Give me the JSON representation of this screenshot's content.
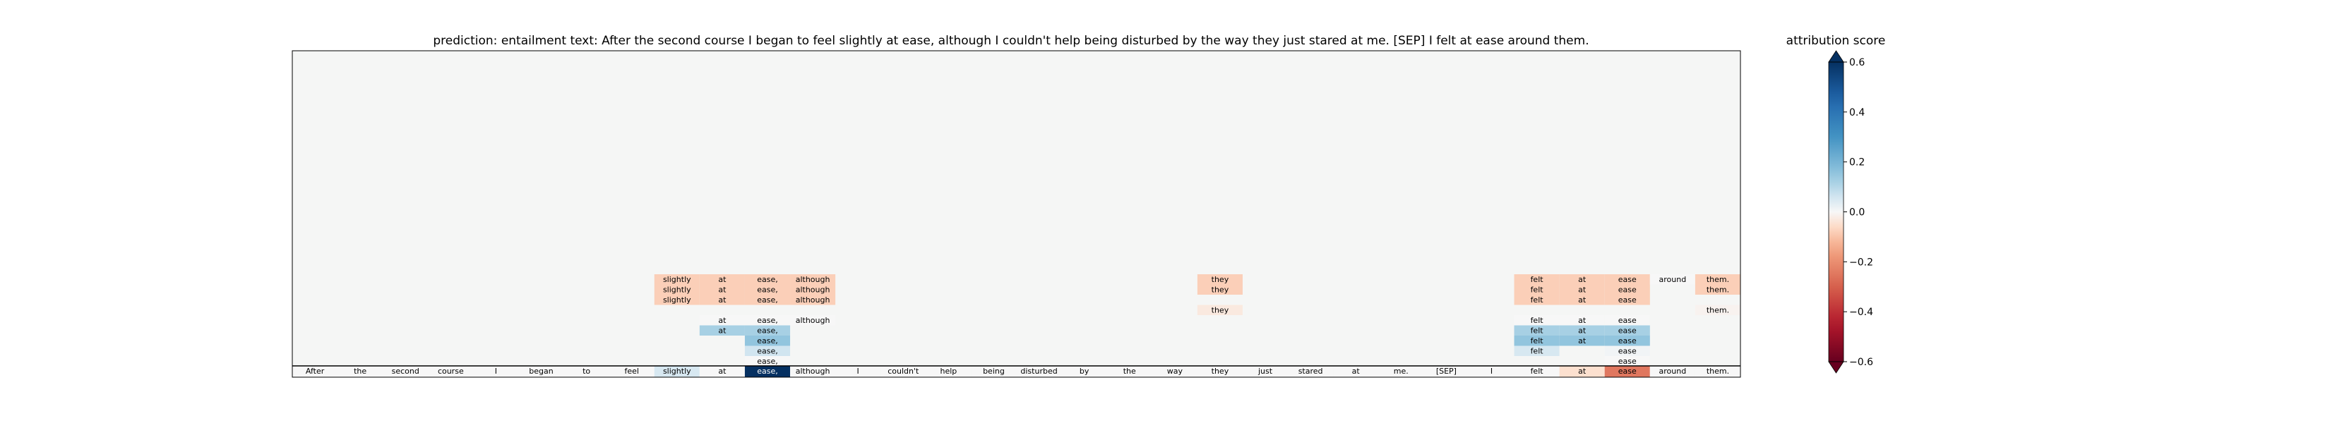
{
  "chart_data": {
    "type": "heatmap",
    "title": "prediction:  entailment     text:  After the second course I began to feel slightly at ease, although I couldn't help being disturbed by the way they just stared at me. [SEP] I felt at ease around them.",
    "tokens": [
      "After",
      "the",
      "second",
      "course",
      "I",
      "began",
      "to",
      "feel",
      "slightly",
      "at",
      "ease,",
      "although",
      "I",
      "couldn't",
      "help",
      "being",
      "disturbed",
      "by",
      "the",
      "way",
      "they",
      "just",
      "stared",
      "at",
      "me.",
      "[SEP]",
      "I",
      "felt",
      "at",
      "ease",
      "around",
      "them."
    ],
    "bottom_row_scores": [
      0,
      0,
      0,
      0,
      0,
      0,
      0,
      0,
      0.05,
      0,
      0.6,
      0,
      0,
      0,
      0,
      0,
      0,
      0,
      0,
      0,
      0,
      0,
      0,
      0,
      0,
      0,
      0,
      0,
      -0.05,
      -0.25,
      0,
      0
    ],
    "cells": [
      {
        "row": 0,
        "col": 8,
        "score": -0.08
      },
      {
        "row": 0,
        "col": 9,
        "score": -0.08
      },
      {
        "row": 0,
        "col": 10,
        "score": -0.08
      },
      {
        "row": 0,
        "col": 11,
        "score": -0.08
      },
      {
        "row": 0,
        "col": 20,
        "score": -0.08
      },
      {
        "row": 0,
        "col": 27,
        "score": -0.08
      },
      {
        "row": 0,
        "col": 28,
        "score": -0.08
      },
      {
        "row": 0,
        "col": 29,
        "score": -0.08
      },
      {
        "row": 0,
        "col": 30,
        "score": 0
      },
      {
        "row": 0,
        "col": 31,
        "score": -0.08
      },
      {
        "row": 1,
        "col": 8,
        "score": -0.08
      },
      {
        "row": 1,
        "col": 9,
        "score": -0.08
      },
      {
        "row": 1,
        "col": 10,
        "score": -0.08
      },
      {
        "row": 1,
        "col": 11,
        "score": -0.08
      },
      {
        "row": 1,
        "col": 20,
        "score": -0.08
      },
      {
        "row": 1,
        "col": 27,
        "score": -0.08
      },
      {
        "row": 1,
        "col": 28,
        "score": -0.08
      },
      {
        "row": 1,
        "col": 29,
        "score": -0.08
      },
      {
        "row": 1,
        "col": 31,
        "score": -0.08
      },
      {
        "row": 2,
        "col": 8,
        "score": -0.08
      },
      {
        "row": 2,
        "col": 9,
        "score": -0.08
      },
      {
        "row": 2,
        "col": 10,
        "score": -0.08
      },
      {
        "row": 2,
        "col": 11,
        "score": -0.08
      },
      {
        "row": 2,
        "col": 27,
        "score": -0.08
      },
      {
        "row": 2,
        "col": 28,
        "score": -0.08
      },
      {
        "row": 2,
        "col": 29,
        "score": -0.08
      },
      {
        "row": 3,
        "col": 20,
        "score": -0.03
      },
      {
        "row": 3,
        "col": 31,
        "score": -0.01
      },
      {
        "row": 4,
        "col": 9,
        "score": 0
      },
      {
        "row": 4,
        "col": 10,
        "score": 0
      },
      {
        "row": 4,
        "col": 11,
        "score": 0
      },
      {
        "row": 4,
        "col": 27,
        "score": 0
      },
      {
        "row": 4,
        "col": 28,
        "score": 0
      },
      {
        "row": 4,
        "col": 29,
        "score": 0
      },
      {
        "row": 5,
        "col": 9,
        "score": 0.12
      },
      {
        "row": 5,
        "col": 10,
        "score": 0.12
      },
      {
        "row": 5,
        "col": 27,
        "score": 0.12
      },
      {
        "row": 5,
        "col": 28,
        "score": 0.12
      },
      {
        "row": 5,
        "col": 29,
        "score": 0.12
      },
      {
        "row": 6,
        "col": 10,
        "score": 0.15
      },
      {
        "row": 6,
        "col": 27,
        "score": 0.15
      },
      {
        "row": 6,
        "col": 28,
        "score": 0.15
      },
      {
        "row": 6,
        "col": 29,
        "score": 0.15
      },
      {
        "row": 7,
        "col": 10,
        "score": 0.06
      },
      {
        "row": 7,
        "col": 27,
        "score": 0.05
      },
      {
        "row": 7,
        "col": 29,
        "score": 0.01
      },
      {
        "row": 8,
        "col": 10,
        "score": 0
      },
      {
        "row": 8,
        "col": 29,
        "score": 0
      }
    ],
    "colorbar": {
      "label": "attribution score",
      "range": [
        -0.6,
        0.6
      ],
      "ticks": [
        {
          "value": 0.6,
          "label": "0.6"
        },
        {
          "value": 0.4,
          "label": "0.4"
        },
        {
          "value": 0.2,
          "label": "0.2"
        },
        {
          "value": 0.0,
          "label": "0.0"
        },
        {
          "value": -0.2,
          "label": "−0.2"
        },
        {
          "value": -0.4,
          "label": "−0.4"
        },
        {
          "value": -0.6,
          "label": "−0.6"
        }
      ]
    },
    "colormap": "RdBu"
  }
}
